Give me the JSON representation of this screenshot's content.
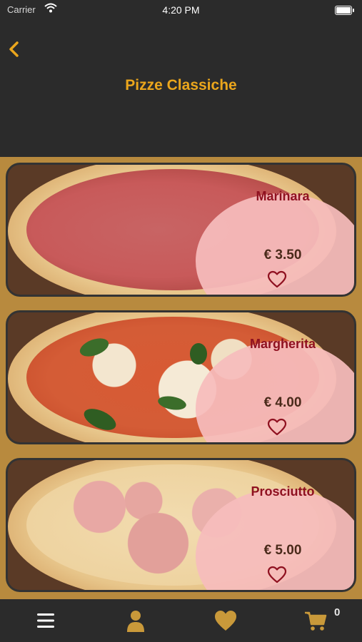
{
  "status": {
    "carrier": "Carrier",
    "time": "4:20 PM"
  },
  "header": {
    "title": "Pizze Classiche"
  },
  "pizzas": [
    {
      "name": "Marinara",
      "price": "€ 3.50"
    },
    {
      "name": "Margherita",
      "price": "€ 4.00"
    },
    {
      "name": "Prosciutto",
      "price": "€ 5.00"
    }
  ],
  "tabbar": {
    "cart_count": "0"
  },
  "icons": {
    "back": "chevron-left-icon",
    "favorite": "heart-outline-icon",
    "menu": "menu-icon",
    "profile": "user-icon",
    "favorites": "heart-filled-icon",
    "cart": "cart-icon"
  },
  "colors": {
    "accent": "#eba61c",
    "name": "#8f1120",
    "tab_icon": "#c9993a",
    "bar": "#2b2b2b"
  }
}
